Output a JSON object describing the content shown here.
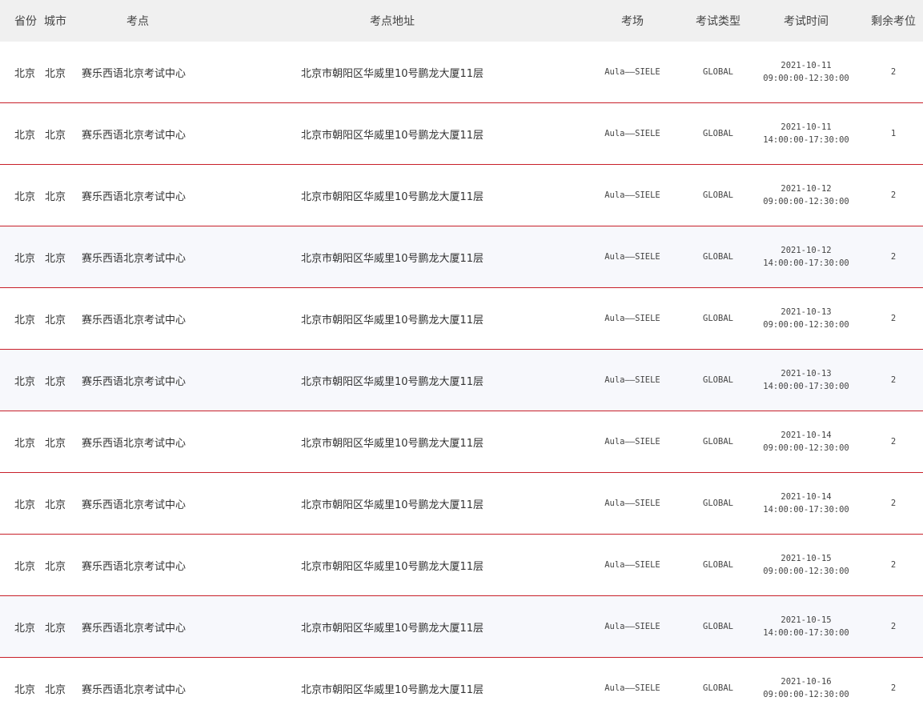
{
  "header": {
    "province": "省份",
    "city": "城市",
    "site": "考点",
    "address": "考点地址",
    "room": "考场",
    "type": "考试类型",
    "time": "考试时间",
    "seats": "剩余考位"
  },
  "rows": [
    {
      "province": "北京",
      "city": "北京",
      "site": "赛乐西语北京考试中心",
      "address": "北京市朝阳区华威里10号鹏龙大厦11层",
      "room": "Aula——SIELE",
      "type": "GLOBAL",
      "date": "2021-10-11",
      "time": "09:00:00-12:30:00",
      "seats": "2"
    },
    {
      "province": "北京",
      "city": "北京",
      "site": "赛乐西语北京考试中心",
      "address": "北京市朝阳区华威里10号鹏龙大厦11层",
      "room": "Aula——SIELE",
      "type": "GLOBAL",
      "date": "2021-10-11",
      "time": "14:00:00-17:30:00",
      "seats": "1"
    },
    {
      "province": "北京",
      "city": "北京",
      "site": "赛乐西语北京考试中心",
      "address": "北京市朝阳区华威里10号鹏龙大厦11层",
      "room": "Aula——SIELE",
      "type": "GLOBAL",
      "date": "2021-10-12",
      "time": "09:00:00-12:30:00",
      "seats": "2"
    },
    {
      "province": "北京",
      "city": "北京",
      "site": "赛乐西语北京考试中心",
      "address": "北京市朝阳区华威里10号鹏龙大厦11层",
      "room": "Aula——SIELE",
      "type": "GLOBAL",
      "date": "2021-10-12",
      "time": "14:00:00-17:30:00",
      "seats": "2"
    },
    {
      "province": "北京",
      "city": "北京",
      "site": "赛乐西语北京考试中心",
      "address": "北京市朝阳区华威里10号鹏龙大厦11层",
      "room": "Aula——SIELE",
      "type": "GLOBAL",
      "date": "2021-10-13",
      "time": "09:00:00-12:30:00",
      "seats": "2"
    },
    {
      "province": "北京",
      "city": "北京",
      "site": "赛乐西语北京考试中心",
      "address": "北京市朝阳区华威里10号鹏龙大厦11层",
      "room": "Aula——SIELE",
      "type": "GLOBAL",
      "date": "2021-10-13",
      "time": "14:00:00-17:30:00",
      "seats": "2"
    },
    {
      "province": "北京",
      "city": "北京",
      "site": "赛乐西语北京考试中心",
      "address": "北京市朝阳区华威里10号鹏龙大厦11层",
      "room": "Aula——SIELE",
      "type": "GLOBAL",
      "date": "2021-10-14",
      "time": "09:00:00-12:30:00",
      "seats": "2"
    },
    {
      "province": "北京",
      "city": "北京",
      "site": "赛乐西语北京考试中心",
      "address": "北京市朝阳区华威里10号鹏龙大厦11层",
      "room": "Aula——SIELE",
      "type": "GLOBAL",
      "date": "2021-10-14",
      "time": "14:00:00-17:30:00",
      "seats": "2"
    },
    {
      "province": "北京",
      "city": "北京",
      "site": "赛乐西语北京考试中心",
      "address": "北京市朝阳区华威里10号鹏龙大厦11层",
      "room": "Aula——SIELE",
      "type": "GLOBAL",
      "date": "2021-10-15",
      "time": "09:00:00-12:30:00",
      "seats": "2"
    },
    {
      "province": "北京",
      "city": "北京",
      "site": "赛乐西语北京考试中心",
      "address": "北京市朝阳区华威里10号鹏龙大厦11层",
      "room": "Aula——SIELE",
      "type": "GLOBAL",
      "date": "2021-10-15",
      "time": "14:00:00-17:30:00",
      "seats": "2"
    },
    {
      "province": "北京",
      "city": "北京",
      "site": "赛乐西语北京考试中心",
      "address": "北京市朝阳区华威里10号鹏龙大厦11层",
      "room": "Aula——SIELE",
      "type": "GLOBAL",
      "date": "2021-10-16",
      "time": "09:00:00-12:30:00",
      "seats": "2"
    }
  ]
}
